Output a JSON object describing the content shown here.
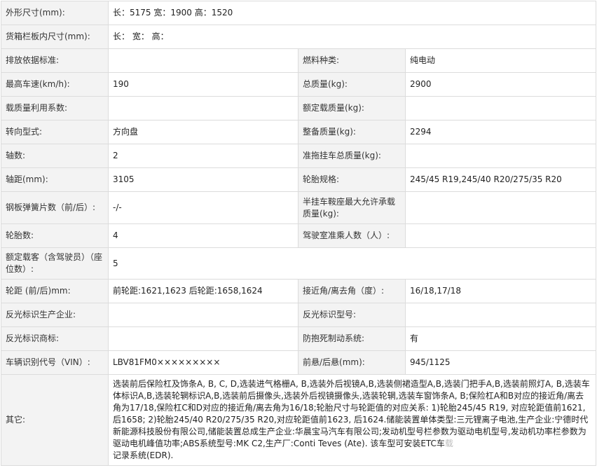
{
  "rows": [
    {
      "type": "wide",
      "label": "外形尺寸(mm):",
      "value": "长：5175 宽：1900 高：1520"
    },
    {
      "type": "wide",
      "label": "货箱栏板内尺寸(mm):",
      "value": "长： 宽： 高："
    },
    {
      "type": "pair",
      "label1": "排放依据标准:",
      "value1": "",
      "label2": "燃料种类:",
      "value2": "纯电动"
    },
    {
      "type": "pair",
      "label1": "最高车速(km/h):",
      "value1": "190",
      "label2": "总质量(kg):",
      "value2": "2900"
    },
    {
      "type": "pair",
      "label1": "载质量利用系数:",
      "value1": "",
      "label2": "额定载质量(kg):",
      "value2": ""
    },
    {
      "type": "pair",
      "label1": "转向型式:",
      "value1": "方向盘",
      "label2": "整备质量(kg):",
      "value2": "2294"
    },
    {
      "type": "pair",
      "label1": "轴数:",
      "value1": "2",
      "label2": "准拖挂车总质量(kg):",
      "value2": ""
    },
    {
      "type": "pair",
      "label1": "轴距(mm):",
      "value1": "3105",
      "label2": "轮胎规格:",
      "value2": "245/45 R19,245/40 R20/275/35 R20"
    },
    {
      "type": "pair",
      "label1": "钢板弹簧片数（前/后）:",
      "value1": "-/-",
      "label2": "半挂车鞍座最大允许承载质量(kg):",
      "value2": ""
    },
    {
      "type": "pair",
      "label1": "轮胎数:",
      "value1": "4",
      "label2": "驾驶室准乘人数（人）:",
      "value2": ""
    },
    {
      "type": "wide",
      "label": "额定载客（含驾驶员）（座位数）:",
      "value": "5"
    },
    {
      "type": "pair",
      "label1": "轮距 (前/后)mm:",
      "value1": "前轮距:1621,1623 后轮距:1658,1624",
      "label2": "接近角/离去角（度）:",
      "value2": "16/18,17/18"
    },
    {
      "type": "pair",
      "label1": "反光标识生产企业:",
      "value1": "",
      "label2": "反光标识型号:",
      "value2": ""
    },
    {
      "type": "pair",
      "label1": "反光标识商标:",
      "value1": "",
      "label2": "防抱死制动系统:",
      "value2": "有"
    },
    {
      "type": "pair",
      "label1": "车辆识别代号（VIN）:",
      "value1": "LBV81FM0×××××××××",
      "label2": "前悬/后悬(mm):",
      "value2": "945/1125"
    }
  ],
  "other": {
    "label": "其它:",
    "text": "选装前后保险杠及饰条A, B, C, D,选装进气格栅A, B,选装外后视镜A,B,选装侧裙造型A,B,选装门把手A,B,选装前照灯A, B,选装车体标识A,B,选装轮辋标识A,B,选装前后摄像头,选装外后视镜摄像头,选装轮辋,选装车窗饰条A, B;保险杠A和B对应的接近角/离去角为17/18,保险杠C和D对应的接近角/离去角为16/18;轮胎尺寸与轮距值的对应关系: 1)轮胎245/45 R19, 对应轮距值前1621,后1658; 2)轮胎245/40 R20/275/35 R20,对应轮距值前1623, 后1624.储能装置单体类型:三元锂离子电池,生产企业:宁德时代新能源科技股份有限公司,储能装置总成生产企业:华晨宝马汽车有限公司;发动机型号栏参数为驱动电机型号,发动机功率栏参数为驱动电机峰值功率;ABS系统型号:MK C2,生产厂:Conti Teves (Ate). 该车型可安装ETC车",
    "faded_text": "载",
    "tail": "记录系统(EDR)."
  }
}
